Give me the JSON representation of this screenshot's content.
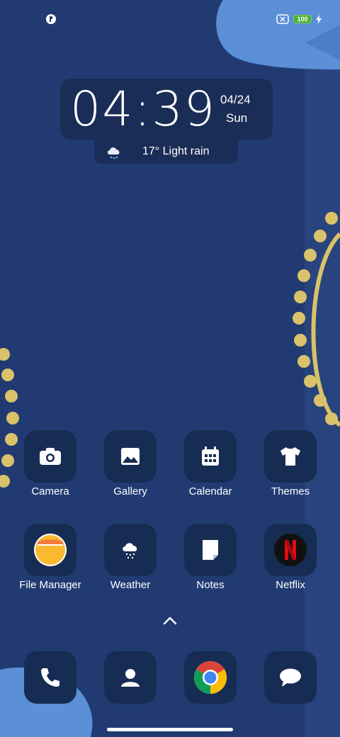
{
  "status_bar": {
    "left_icon": "app-notification-icon",
    "battery_level": "100",
    "battery_color": "#4caf3c",
    "charging_icon": "lightning-icon",
    "sim_icon": "no-sim-icon"
  },
  "clock": {
    "time": "04:39",
    "date": "04/24",
    "day": "Sun"
  },
  "weather": {
    "icon": "rain-cloud-icon",
    "text": "17° Light rain"
  },
  "apps": [
    {
      "label": "Camera",
      "icon": "camera-icon"
    },
    {
      "label": "Gallery",
      "icon": "image-icon"
    },
    {
      "label": "Calendar",
      "icon": "calendar-icon"
    },
    {
      "label": "Themes",
      "icon": "tshirt-icon"
    },
    {
      "label": "File Manager",
      "icon": "folder-icon"
    },
    {
      "label": "Weather",
      "icon": "snow-cloud-icon"
    },
    {
      "label": "Notes",
      "icon": "note-icon"
    },
    {
      "label": "Netflix",
      "icon": "netflix-icon"
    }
  ],
  "dock": [
    {
      "icon": "phone-icon"
    },
    {
      "icon": "contacts-icon"
    },
    {
      "icon": "chrome-icon"
    },
    {
      "icon": "messages-icon"
    }
  ],
  "colors": {
    "background": "#213b72",
    "tile": "#172c52",
    "accent_gold": "#d9c26a",
    "accent_blue": "#5b8fd6"
  }
}
